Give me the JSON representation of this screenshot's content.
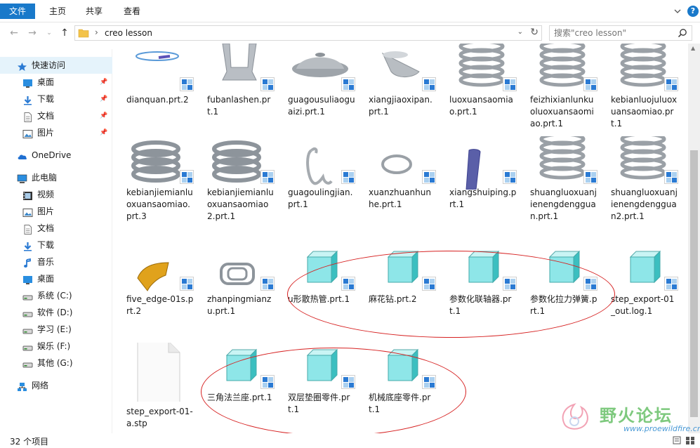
{
  "ribbon": {
    "tabs": [
      "文件",
      "主页",
      "共享",
      "查看"
    ]
  },
  "address": {
    "path": "creo lesson",
    "separator": "›"
  },
  "search": {
    "placeholder": "搜索\"creo lesson\""
  },
  "sidebar": {
    "items": [
      {
        "label": "快速访问",
        "icon": "star-icon",
        "pinned": false
      },
      {
        "label": "桌面",
        "icon": "desktop-icon",
        "pinned": true
      },
      {
        "label": "下载",
        "icon": "download-icon",
        "pinned": true
      },
      {
        "label": "文档",
        "icon": "document-icon",
        "pinned": true
      },
      {
        "label": "图片",
        "icon": "picture-icon",
        "pinned": true
      },
      {
        "label": "OneDrive",
        "icon": "cloud-icon",
        "pinned": false
      },
      {
        "label": "此电脑",
        "icon": "computer-icon",
        "pinned": false
      },
      {
        "label": "视频",
        "icon": "video-icon",
        "pinned": false
      },
      {
        "label": "图片",
        "icon": "picture-icon",
        "pinned": false
      },
      {
        "label": "文档",
        "icon": "document-icon",
        "pinned": false
      },
      {
        "label": "下载",
        "icon": "download-icon",
        "pinned": false
      },
      {
        "label": "音乐",
        "icon": "music-icon",
        "pinned": false
      },
      {
        "label": "桌面",
        "icon": "desktop-icon",
        "pinned": false
      },
      {
        "label": "系统 (C:)",
        "icon": "drive-icon",
        "pinned": false
      },
      {
        "label": "软件 (D:)",
        "icon": "drive-icon",
        "pinned": false
      },
      {
        "label": "学习 (E:)",
        "icon": "drive-icon",
        "pinned": false
      },
      {
        "label": "娱乐 (F:)",
        "icon": "drive-icon",
        "pinned": false
      },
      {
        "label": "其他 (G:)",
        "icon": "drive-icon",
        "pinned": false
      },
      {
        "label": "网络",
        "icon": "network-icon",
        "pinned": false
      }
    ]
  },
  "files": [
    {
      "name": "dianquan.prt.2",
      "thumb": "ring"
    },
    {
      "name": "fubanlashen.prt.1",
      "thumb": "frame"
    },
    {
      "name": "guagousuliaoguaizi.prt.1",
      "thumb": "dome"
    },
    {
      "name": "xiangjiaoxipan.prt.1",
      "thumb": "cup"
    },
    {
      "name": "luoxuansaomiao.prt.1",
      "thumb": "spring"
    },
    {
      "name": "feizhixianlunkuoluoxuansaomiao.prt.1",
      "thumb": "spring"
    },
    {
      "name": "kebianluojuluoxuansaomiao.prt.1",
      "thumb": "spring"
    },
    {
      "name": "kebianjiemianluoxuansaomiao.prt.3",
      "thumb": "coil"
    },
    {
      "name": "kebianjiemianluoxuansaomiao2.prt.1",
      "thumb": "coil"
    },
    {
      "name": "guagoulingjian.prt.1",
      "thumb": "hook"
    },
    {
      "name": "xuanzhuanhunhe.prt.1",
      "thumb": "twist"
    },
    {
      "name": "xiangshuiping.prt.1",
      "thumb": "tube"
    },
    {
      "name": "shuangluoxuanjienengdengguan.prt.1",
      "thumb": "spring"
    },
    {
      "name": "shuangluoxuanjienengdengguan2.prt.1",
      "thumb": "spring"
    },
    {
      "name": "five_edge-01s.prt.2",
      "thumb": "gold"
    },
    {
      "name": "zhanpingmianzu.prt.1",
      "thumb": "buckle"
    },
    {
      "name": "u形散热管.prt.1",
      "thumb": "cube"
    },
    {
      "name": "麻花钻.prt.2",
      "thumb": "cube"
    },
    {
      "name": "参数化联轴器.prt.1",
      "thumb": "cube"
    },
    {
      "name": "参数化拉力弹簧.prt.1",
      "thumb": "cube"
    },
    {
      "name": "step_export-01_out.log.1",
      "thumb": "cube"
    },
    {
      "name": "step_export-01-a.stp",
      "thumb": "blank"
    },
    {
      "name": "三角法兰座.prt.1",
      "thumb": "cube"
    },
    {
      "name": "双层垫圈零件.prt.1",
      "thumb": "cube"
    },
    {
      "name": "机械底座零件.prt.1",
      "thumb": "cube"
    }
  ],
  "status": {
    "count": "32 个项目"
  },
  "watermark": {
    "text": "野火论坛",
    "url": "www.proewildfire.cn"
  }
}
